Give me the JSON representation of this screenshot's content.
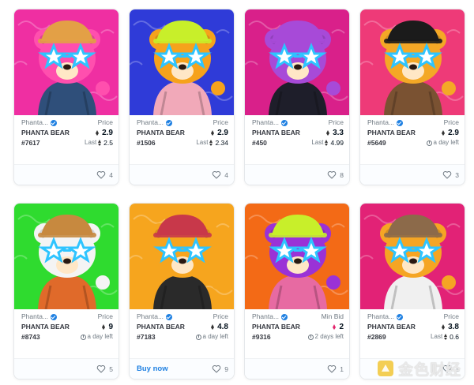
{
  "cards": [
    {
      "collection": "Phanta...",
      "name": "PHANTA BEAR #7617",
      "price_label": "Price",
      "price": "2.9",
      "sub_label": "Last",
      "sub_value": "2.5",
      "sub_type": "last",
      "likes": "4",
      "buy_now": "",
      "bg": "#ef2fa2",
      "bear": "#ff4fae",
      "hat": "#e3a046",
      "outfit": "#2f4f7a"
    },
    {
      "collection": "Phanta...",
      "name": "PHANTA BEAR #1506",
      "price_label": "Price",
      "price": "2.9",
      "sub_label": "Last",
      "sub_value": "2.34",
      "sub_type": "last",
      "likes": "4",
      "buy_now": "",
      "bg": "#2f3bd8",
      "bear": "#f6a21c",
      "hat": "#c8ef2a",
      "outfit": "#f1a9b9"
    },
    {
      "collection": "Phanta...",
      "name": "PHANTA BEAR #450",
      "price_label": "Price",
      "price": "3.3",
      "sub_label": "Last",
      "sub_value": "4.99",
      "sub_type": "last",
      "likes": "8",
      "buy_now": "",
      "bg": "#d9208a",
      "bear": "#a74ad8",
      "hat": "#a74ad8",
      "outfit": "#1e1e2a"
    },
    {
      "collection": "Phanta...",
      "name": "PHANTA BEAR #5649",
      "price_label": "Price",
      "price": "2.9",
      "sub_label": "",
      "sub_value": "a day left",
      "sub_type": "time",
      "likes": "3",
      "buy_now": "",
      "bg": "#ee3a78",
      "bear": "#f4a826",
      "hat": "#1b1b1b",
      "outfit": "#7a5232"
    },
    {
      "collection": "Phanta...",
      "name": "PHANTA BEAR #8743",
      "price_label": "Price",
      "price": "9",
      "sub_label": "",
      "sub_value": "a day left",
      "sub_type": "time",
      "likes": "5",
      "buy_now": "",
      "bg": "#2fdb2f",
      "bear": "#f4f4f4",
      "hat": "#c7893f",
      "outfit": "#e06a2a"
    },
    {
      "collection": "Phanta...",
      "name": "PHANTA BEAR #7183",
      "price_label": "Price",
      "price": "4.8",
      "sub_label": "",
      "sub_value": "a day left",
      "sub_type": "time",
      "likes": "9",
      "buy_now": "Buy now",
      "bg": "#f6a51e",
      "bear": "#f6a51e",
      "hat": "#c8384a",
      "outfit": "#2a2a2a"
    },
    {
      "collection": "Phanta...",
      "name": "PHANTA BEAR #9316",
      "price_label": "Min Bid",
      "price": "2",
      "sub_label": "",
      "sub_value": "2 days left",
      "sub_type": "time",
      "likes": "1",
      "buy_now": "",
      "bg": "#f36a16",
      "bear": "#9a32d6",
      "hat": "#c8ef2a",
      "outfit": "#e76aa2"
    },
    {
      "collection": "Phanta...",
      "name": "PHANTA BEAR #2869",
      "price_label": "Price",
      "price": "3.8",
      "sub_label": "Last",
      "sub_value": "0.6",
      "sub_type": "last",
      "likes": "1",
      "buy_now": "",
      "bg": "#e22276",
      "bear": "#f5a524",
      "hat": "#8c6a4a",
      "outfit": "#f0f0f0"
    }
  ],
  "colors": {
    "accent": "#2081e2",
    "min_bid_eth": "#e2246c",
    "muted": "#707a83"
  },
  "watermark": {
    "text": "金色财经"
  }
}
